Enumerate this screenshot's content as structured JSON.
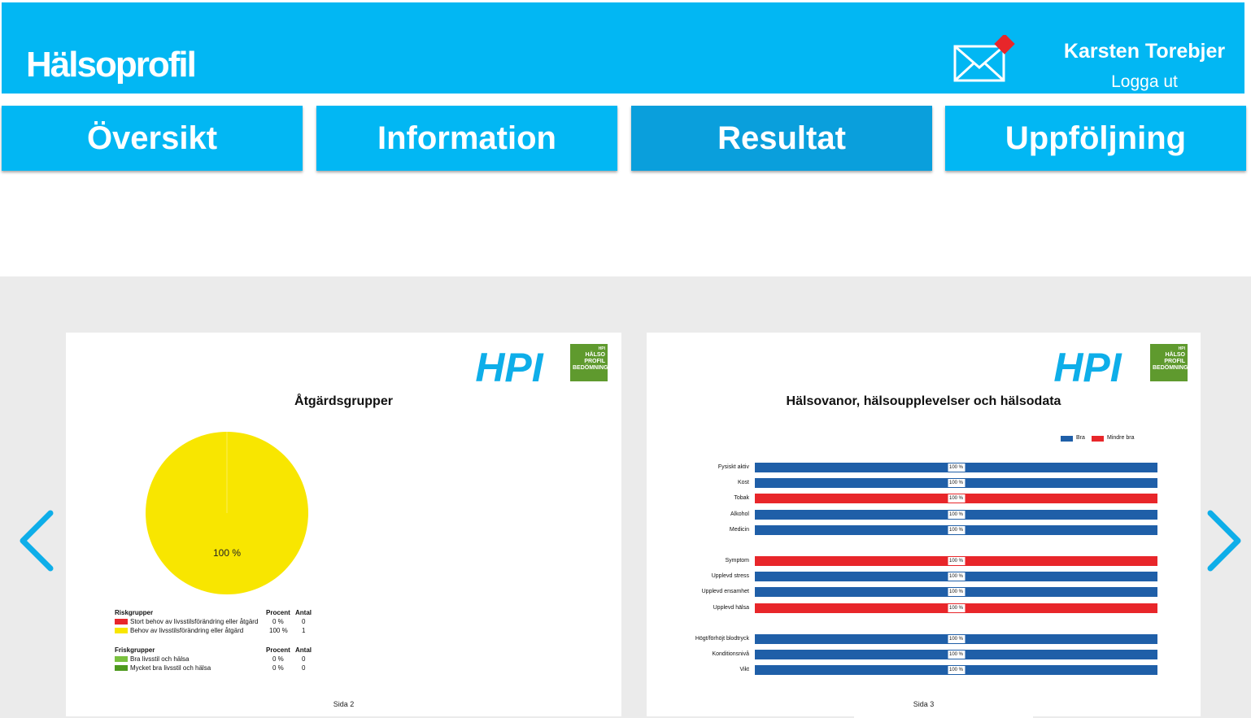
{
  "header": {
    "app_title": "Hälsoprofil",
    "user_name": "Karsten Torebjer",
    "logout_label": "Logga ut"
  },
  "tabs": [
    {
      "label": "Översikt",
      "active": false
    },
    {
      "label": "Information",
      "active": false
    },
    {
      "label": "Resultat",
      "active": true
    },
    {
      "label": "Uppföljning",
      "active": false
    }
  ],
  "brand": {
    "logo_text": "HPI",
    "badge_lines": [
      "HPI",
      "HÄLSO",
      "PROFIL",
      "BEDÖMNING"
    ],
    "primary_color": "#02b7f3"
  },
  "page_left": {
    "heading": "Åtgärdsgrupper",
    "footer": "Sida 2",
    "chart_data": {
      "type": "pie",
      "title": "Åtgärdsgrupper",
      "slices": [
        {
          "label": "Stort behov av livsstilsförändring eller åtgärd",
          "percent": 0,
          "count": 0,
          "color": "#e8262a"
        },
        {
          "label": "Behov av livsstilsförändring eller åtgärd",
          "percent": 100,
          "count": 1,
          "color": "#f8e600"
        },
        {
          "label": "Bra livsstil och hälsa",
          "percent": 0,
          "count": 0,
          "color": "#7ac13f"
        },
        {
          "label": "Mycket bra livsstil och hälsa",
          "percent": 0,
          "count": 0,
          "color": "#4f9a1f"
        }
      ],
      "slice_label": "100 %"
    },
    "legend": {
      "risk_title": "Riskgrupper",
      "healthy_title": "Friskgrupper",
      "col_percent": "Procent",
      "col_count": "Antal",
      "risk_rows": [
        {
          "label": "Stort behov av livsstilsförändring eller åtgärd",
          "percent": "0 %",
          "count": "0",
          "color": "#e8262a"
        },
        {
          "label": "Behov av livsstilsförändring eller åtgärd",
          "percent": "100 %",
          "count": "1",
          "color": "#f8e600"
        }
      ],
      "healthy_rows": [
        {
          "label": "Bra livsstil och hälsa",
          "percent": "0 %",
          "count": "0",
          "color": "#7ac13f"
        },
        {
          "label": "Mycket bra livsstil och hälsa",
          "percent": "0 %",
          "count": "0",
          "color": "#4f9a1f"
        }
      ]
    }
  },
  "page_right": {
    "heading": "Hälsovanor, hälsoupplevelser och hälsodata",
    "footer": "Sida 3",
    "chart_data": {
      "type": "bar",
      "orientation": "horizontal",
      "stacked": true,
      "title": "Hälsovanor, hälsoupplevelser och hälsodata",
      "legend": [
        {
          "name": "Bra",
          "color": "#1f5fa8"
        },
        {
          "name": "Mindre bra",
          "color": "#e8262a"
        }
      ],
      "legend_position": "top-right",
      "groups": [
        [
          {
            "label": "Fysiskt aktiv",
            "status": "Bra",
            "value": 100,
            "value_label": "100 %"
          },
          {
            "label": "Kost",
            "status": "Bra",
            "value": 100,
            "value_label": "100 %"
          },
          {
            "label": "Tobak",
            "status": "Mindre bra",
            "value": 100,
            "value_label": "100 %"
          },
          {
            "label": "Alkohol",
            "status": "Bra",
            "value": 100,
            "value_label": "100 %"
          },
          {
            "label": "Medicin",
            "status": "Bra",
            "value": 100,
            "value_label": "100 %"
          }
        ],
        [
          {
            "label": "Symptom",
            "status": "Mindre bra",
            "value": 100,
            "value_label": "100 %"
          },
          {
            "label": "Upplevd stress",
            "status": "Bra",
            "value": 100,
            "value_label": "100 %"
          },
          {
            "label": "Upplevd ensamhet",
            "status": "Bra",
            "value": 100,
            "value_label": "100 %"
          },
          {
            "label": "Upplevd hälsa",
            "status": "Mindre bra",
            "value": 100,
            "value_label": "100 %"
          }
        ],
        [
          {
            "label": "Högt/förhöjt blodtryck",
            "status": "Bra",
            "value": 100,
            "value_label": "100 %"
          },
          {
            "label": "Konditionsnivå",
            "status": "Bra",
            "value": 100,
            "value_label": "100 %"
          },
          {
            "label": "Vikt",
            "status": "Bra",
            "value": 100,
            "value_label": "100 %"
          }
        ]
      ]
    }
  },
  "nav": {
    "prev_icon": "chevron-left-icon",
    "next_icon": "chevron-right-icon"
  }
}
